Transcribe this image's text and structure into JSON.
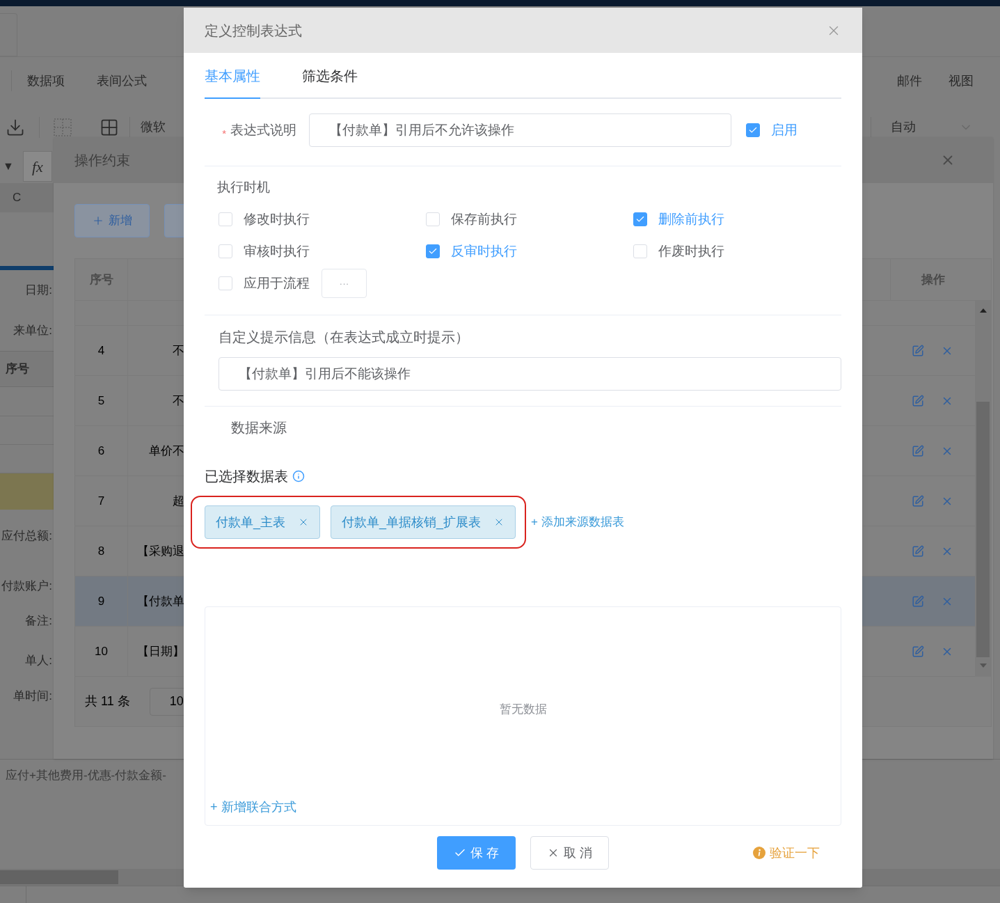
{
  "app": {
    "menu_left": [
      {
        "label": "数据项"
      },
      {
        "label": "表间公式"
      }
    ],
    "menu_right": [
      {
        "label": "邮件"
      },
      {
        "label": "视图"
      }
    ],
    "font_name": "微软",
    "size_mode": "自动",
    "name_box_arrow": "▼",
    "fx": "fx",
    "column_header": "C",
    "labels_top": [
      "日期:",
      "来单位:"
    ],
    "grid_header": "序号",
    "labels_bottom": [
      {
        "text": "应付总额:"
      },
      {
        "text": "付款账户:"
      },
      {
        "text": "备注:"
      },
      {
        "text": "单人:"
      },
      {
        "text": "单时间:"
      }
    ],
    "formula_text": "应付+其他费用-优惠-付款金额-"
  },
  "constraint_dialog": {
    "title": "操作约束",
    "add_button": "新增",
    "columns": [
      "序号",
      "操作"
    ],
    "rows": [
      {
        "index": "4",
        "text": "不",
        "selected": false
      },
      {
        "index": "5",
        "text": "不",
        "selected": false
      },
      {
        "index": "6",
        "text": "单价不",
        "selected": false
      },
      {
        "index": "7",
        "text": "超",
        "selected": false
      },
      {
        "index": "8",
        "text": "【采购退",
        "selected": false
      },
      {
        "index": "9",
        "text": "【付款单",
        "selected": true
      },
      {
        "index": "10",
        "text": "【日期】",
        "selected": false
      }
    ],
    "total": "共 11 条",
    "page_size": "10"
  },
  "dialog": {
    "title": "定义控制表达式",
    "tabs": [
      {
        "label": "基本属性",
        "selected": true
      },
      {
        "label": "筛选条件",
        "selected": false
      }
    ],
    "expression": {
      "label": "表达式说明",
      "required_mark": "*",
      "value": "【付款单】引用后不允许该操作"
    },
    "enabled": {
      "label": "启用",
      "checked": true
    },
    "timing": {
      "title": "执行时机",
      "options": [
        {
          "label": "修改时执行",
          "checked": false
        },
        {
          "label": "保存前执行",
          "checked": false
        },
        {
          "label": "删除前执行",
          "checked": true
        },
        {
          "label": "审核时执行",
          "checked": false
        },
        {
          "label": "反审时执行",
          "checked": true
        },
        {
          "label": "作废时执行",
          "checked": false
        },
        {
          "label": "应用于流程",
          "checked": false,
          "more_button": "···"
        }
      ]
    },
    "message": {
      "label": "自定义提示信息（在表达式成立时提示）",
      "value": "【付款单】引用后不能该操作"
    },
    "data_source": {
      "title": "数据来源",
      "selected_label": "已选择数据表",
      "highlighted": true,
      "tables": [
        {
          "name": "付款单_主表"
        },
        {
          "name": "付款单_单据核销_扩展表"
        }
      ],
      "add_link": "+ 添加来源数据表",
      "empty_text": "暂无数据",
      "add_join": "+ 新增联合方式"
    },
    "buttons": {
      "save": "保 存",
      "cancel": "取 消",
      "verify": "验证一下"
    }
  }
}
